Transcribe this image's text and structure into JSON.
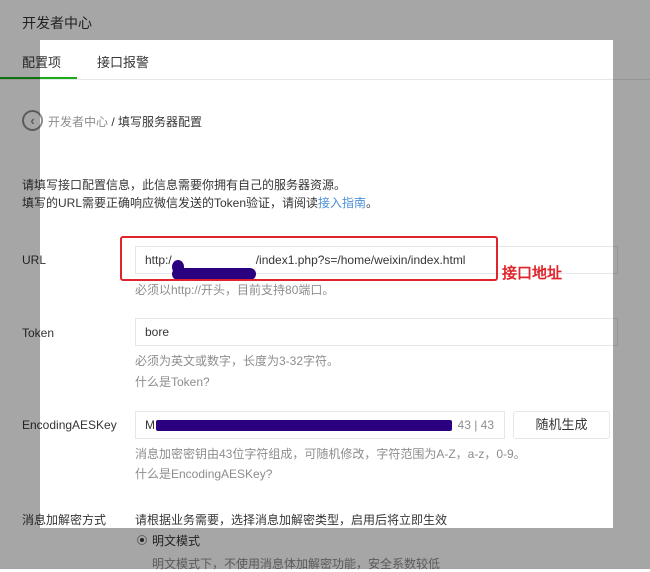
{
  "header": {
    "title": "开发者中心"
  },
  "tabs": [
    {
      "label": "配置项",
      "active": true
    },
    {
      "label": "接口报警",
      "active": false
    }
  ],
  "breadcrumb": {
    "parent": "开发者中心",
    "separator": " / ",
    "current": "填写服务器配置"
  },
  "intro": {
    "line1": "请填写接口配置信息，此信息需要你拥有自己的服务器资源。",
    "line2_prefix": "填写的URL需要正确响应微信发送的Token验证，请阅读",
    "line2_link": "接入指南",
    "line2_suffix": "。"
  },
  "form": {
    "url": {
      "label": "URL",
      "value_prefix": "http:/",
      "value_suffix": "/index1.php?s=/home/weixin/index.html",
      "hint": "必须以http://开头，目前支持80端口。",
      "annotation": "接口地址"
    },
    "token": {
      "label": "Token",
      "value": "bore",
      "hint": "必须为英文或数字，长度为3-32字符。",
      "link": "什么是Token?"
    },
    "aeskey": {
      "label": "EncodingAESKey",
      "value_prefix": "M",
      "count": "43 | 43",
      "button": "随机生成",
      "hint": "消息加密密钥由43位字符组成，可随机修改，字符范围为A-Z，a-z，0-9。",
      "link": "什么是EncodingAESKey?"
    },
    "encryption": {
      "label": "消息加解密方式",
      "desc": "请根据业务需要，选择消息加解密类型，启用后将立即生效",
      "option": "明文模式",
      "option_desc": "明文模式下，不使用消息体加解密功能，安全系数较低"
    }
  },
  "colors": {
    "accent": "#1aad19",
    "link": "#4a90d9",
    "annotation": "#e0242b",
    "redaction": "#2a0080"
  }
}
